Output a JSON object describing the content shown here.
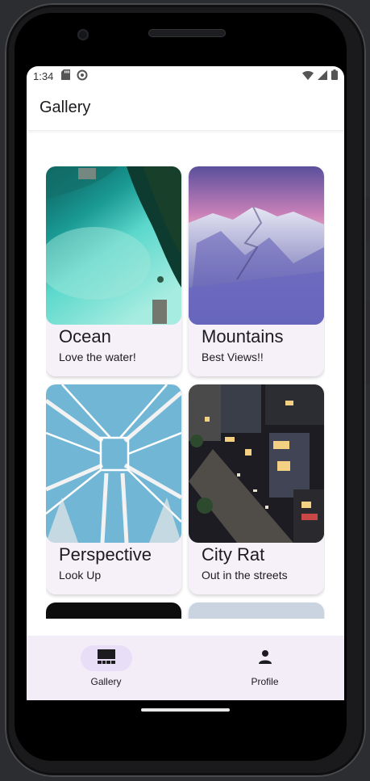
{
  "status_bar": {
    "time": "1:34"
  },
  "top_bar": {
    "title": "Gallery"
  },
  "cards": [
    {
      "title": "Ocean",
      "subtitle": "Love the water!",
      "image_icon": "ocean-photo"
    },
    {
      "title": "Mountains",
      "subtitle": "Best Views!!",
      "image_icon": "mountains-photo"
    },
    {
      "title": "Perspective",
      "subtitle": "Look Up",
      "image_icon": "ferris-wheel-photo"
    },
    {
      "title": "City Rat",
      "subtitle": "Out in the streets",
      "image_icon": "city-photo"
    }
  ],
  "bottom_nav": {
    "items": [
      {
        "label": "Gallery",
        "icon": "gallery-icon",
        "active": true
      },
      {
        "label": "Profile",
        "icon": "person-icon",
        "active": false
      }
    ]
  },
  "colors": {
    "nav_bg": "#f3edf7",
    "active_pill": "#e8def8",
    "card_bg": "#f6f1f8"
  }
}
